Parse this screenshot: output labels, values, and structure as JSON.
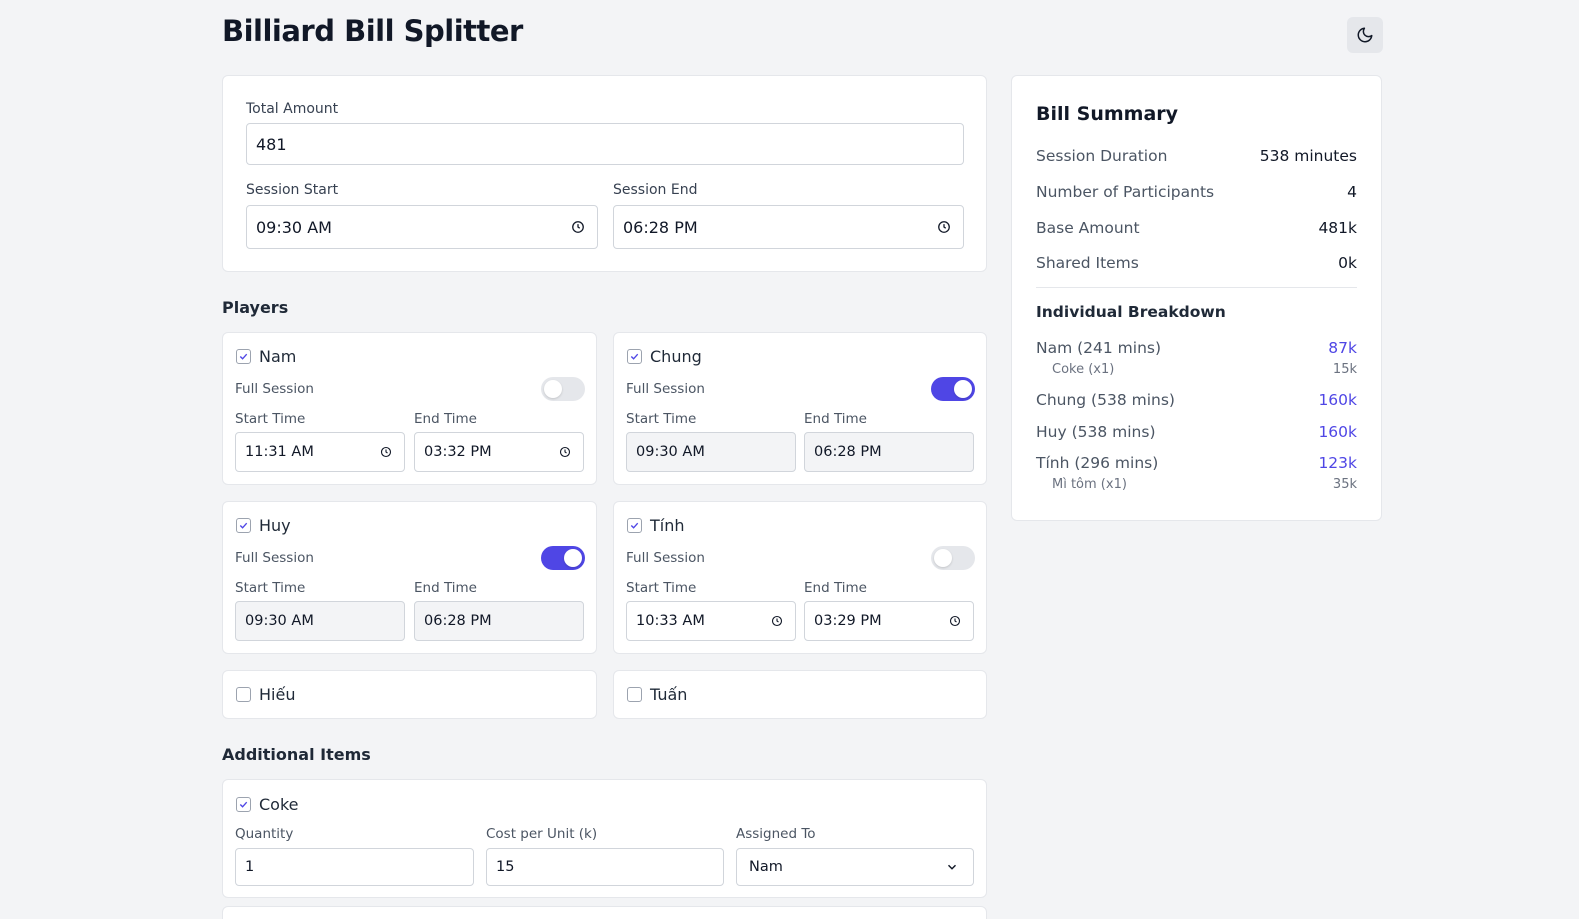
{
  "header": {
    "title": "Billiard Bill Splitter",
    "theme_icon": "moon-icon"
  },
  "bill": {
    "total_label": "Total Amount",
    "total_value": "481",
    "start_label": "Session Start",
    "start_value": "09:30 AM",
    "end_label": "Session End",
    "end_value": "06:28 PM"
  },
  "players": {
    "title": "Players",
    "full_session_label": "Full Session",
    "start_label": "Start Time",
    "end_label": "End Time",
    "list": [
      {
        "name": "Nam",
        "checked": true,
        "full": false,
        "start": "11:31 AM",
        "end": "03:32 PM"
      },
      {
        "name": "Chung",
        "checked": true,
        "full": true,
        "start": "09:30 AM",
        "end": "06:28 PM"
      },
      {
        "name": "Huy",
        "checked": true,
        "full": true,
        "start": "09:30 AM",
        "end": "06:28 PM"
      },
      {
        "name": "Tính",
        "checked": true,
        "full": false,
        "start": "10:33 AM",
        "end": "03:29 PM"
      },
      {
        "name": "Hiếu",
        "checked": false
      },
      {
        "name": "Tuấn",
        "checked": false
      }
    ]
  },
  "items": {
    "title": "Additional Items",
    "list": [
      {
        "name": "Coke",
        "checked": true,
        "qty_label": "Quantity",
        "qty": "1",
        "cost_label": "Cost per Unit (k)",
        "cost": "15",
        "assigned_label": "Assigned To",
        "assigned": "Nam"
      }
    ]
  },
  "summary": {
    "title": "Bill Summary",
    "rows": [
      {
        "label": "Session Duration",
        "value": "538 minutes"
      },
      {
        "label": "Number of Participants",
        "value": "4"
      },
      {
        "label": "Base Amount",
        "value": "481k"
      },
      {
        "label": "Shared Items",
        "value": "0k"
      }
    ],
    "breakdown_title": "Individual Breakdown",
    "breakdown": [
      {
        "label": "Nam (241 mins)",
        "value": "87k",
        "sub": [
          {
            "label": "Coke (x1)",
            "value": "15k"
          }
        ]
      },
      {
        "label": "Chung (538 mins)",
        "value": "160k",
        "sub": []
      },
      {
        "label": "Huy (538 mins)",
        "value": "160k",
        "sub": []
      },
      {
        "label": "Tính (296 mins)",
        "value": "123k",
        "sub": [
          {
            "label": "Mì tôm (x1)",
            "value": "35k"
          }
        ]
      }
    ]
  },
  "colors": {
    "accent": "#4f46e5",
    "bg": "#f3f4f6"
  }
}
